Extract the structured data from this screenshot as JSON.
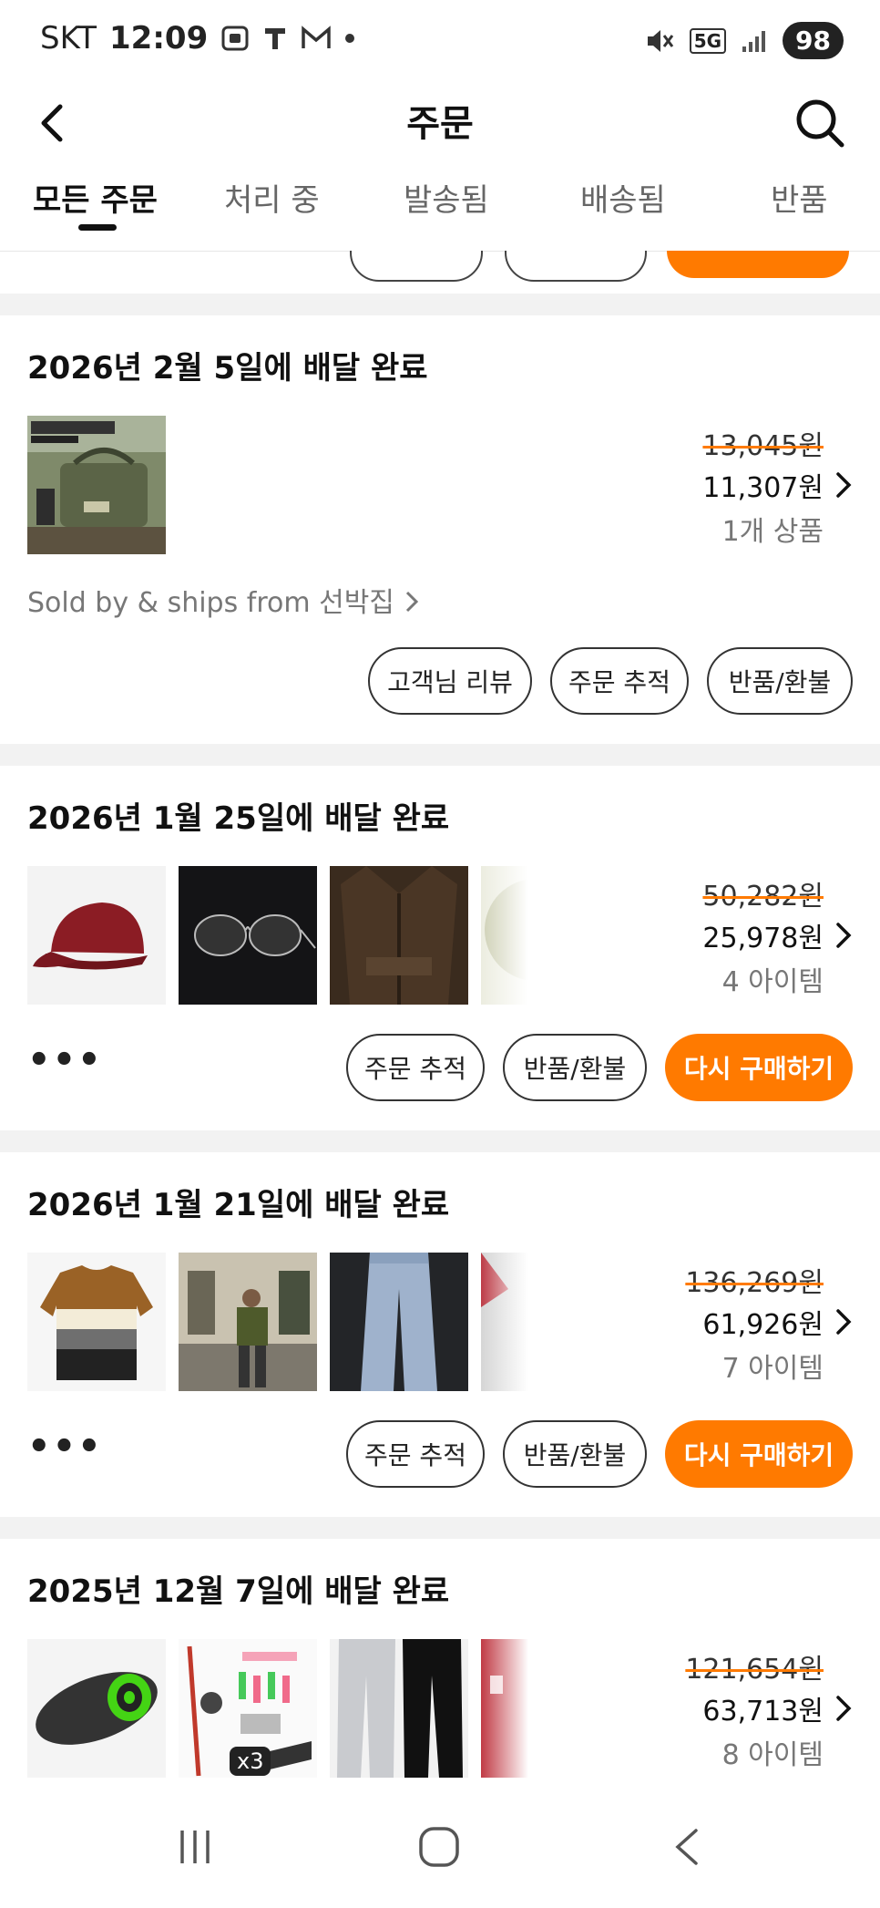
{
  "status_bar": {
    "carrier": "SKT",
    "time": "12:09",
    "network": "5G",
    "battery": "98"
  },
  "header": {
    "title": "주문"
  },
  "tabs": [
    {
      "label": "모든 주문",
      "active": true
    },
    {
      "label": "처리 중"
    },
    {
      "label": "발송됨"
    },
    {
      "label": "배송됨"
    },
    {
      "label": "반품"
    }
  ],
  "orders": [
    {
      "date": "2026년 2월 5일에 배달 완료",
      "original_price": "13,045원",
      "price": "11,307원",
      "count": "1개 상품",
      "seller": "Sold by & ships from 선박집",
      "thumb_label": "TACTICAL / 8SCAMP",
      "buttons": [
        "고객님 리뷰",
        "주문 추적",
        "반품/환불"
      ]
    },
    {
      "date": "2026년 1월 25일에 배달 완료",
      "original_price": "50,282원",
      "price": "25,978원",
      "count": "4 아이템",
      "more": "•••",
      "buttons": [
        "주문 추적",
        "반품/환불",
        "다시 구매하기"
      ]
    },
    {
      "date": "2026년 1월 21일에 배달 완료",
      "original_price": "136,269원",
      "price": "61,926원",
      "count": "7 아이템",
      "more": "•••",
      "buttons": [
        "주문 추적",
        "반품/환불",
        "다시 구매하기"
      ]
    },
    {
      "date": "2025년 12월 7일에 배달 완료",
      "original_price": "121,654원",
      "price": "63,713원",
      "count": "8 아이템",
      "badge": "x3"
    }
  ],
  "colors": {
    "accent": "#ff7a00",
    "divider": "#f2f2f2"
  }
}
